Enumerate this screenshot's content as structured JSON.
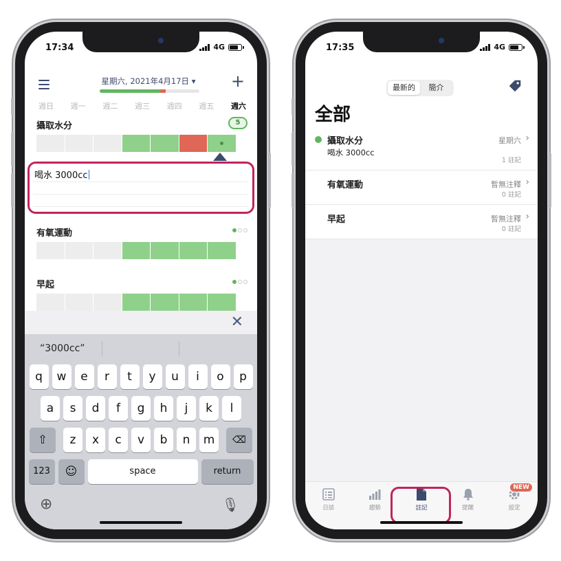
{
  "left": {
    "status": {
      "time": "17:34",
      "network": "4G"
    },
    "header": {
      "date": "星期六, 2021年4月17日 ▾",
      "progress_green": 0.61,
      "progress_red": 0.05
    },
    "weekdays": [
      "週日",
      "週一",
      "週二",
      "週三",
      "週四",
      "週五",
      "週六"
    ],
    "habits": [
      {
        "title": "攝取水分",
        "badge": "5"
      },
      {
        "title": "有氧運動"
      },
      {
        "title": "早起"
      }
    ],
    "note": {
      "text": "喝水 3000cc"
    },
    "keyboard": {
      "suggestion": "“3000cc”",
      "row1": [
        "q",
        "w",
        "e",
        "r",
        "t",
        "y",
        "u",
        "i",
        "o",
        "p"
      ],
      "row2": [
        "a",
        "s",
        "d",
        "f",
        "g",
        "h",
        "j",
        "k",
        "l"
      ],
      "row3": [
        "z",
        "x",
        "c",
        "v",
        "b",
        "n",
        "m"
      ],
      "numbers": "123",
      "space": "space",
      "return": "return"
    },
    "colors": {
      "green": "#8fd18a",
      "red": "#e06655",
      "accent": "#3c4a6b",
      "highlight": "#c0245c"
    }
  },
  "right": {
    "status": {
      "time": "17:35",
      "network": "4G"
    },
    "segments": [
      "最新的",
      "簡介"
    ],
    "title": "全部",
    "items": [
      {
        "title": "攝取水分",
        "note": "喝水 3000cc",
        "date": "星期六",
        "count": "1 註記"
      },
      {
        "title": "有氧運動",
        "date": "暫無注釋",
        "count": "0 註記"
      },
      {
        "title": "早起",
        "date": "暫無注釋",
        "count": "0 註記"
      }
    ],
    "tabs": [
      {
        "label": "日誌",
        "icon": "list-icon"
      },
      {
        "label": "趨勢",
        "icon": "bar-chart-icon"
      },
      {
        "label": "註記",
        "icon": "document-icon"
      },
      {
        "label": "提醒",
        "icon": "bell-icon"
      },
      {
        "label": "設定",
        "icon": "gear-icon",
        "badge": "NEW"
      }
    ]
  }
}
